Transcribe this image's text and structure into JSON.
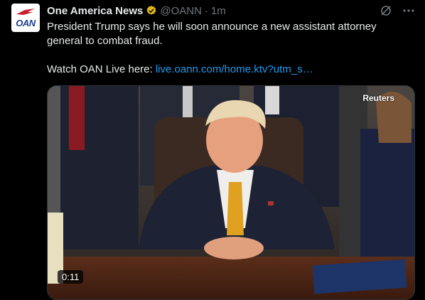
{
  "account": {
    "name": "One America News",
    "handle": "@OANN",
    "separator": "·",
    "time": "1m",
    "avatar_label": "OAN"
  },
  "tweet": {
    "text_line1": "President Trump says he will soon announce a new assistant attorney general to combat fraud.",
    "watch_prefix": "Watch OAN Live here: ",
    "link_text": "live.oann.com/home.ktv?utm_s…"
  },
  "media": {
    "watermark": "Reuters",
    "duration": "0:11"
  },
  "icons": {
    "verified": "verified-badge-icon",
    "grok": "grok-icon",
    "more": "more-options-icon"
  },
  "colors": {
    "background": "#000000",
    "link": "#1d9bf0",
    "verified": "#e2b719",
    "muted": "#71767b"
  }
}
